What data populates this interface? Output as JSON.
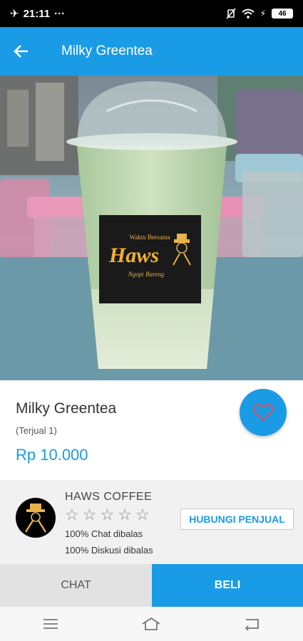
{
  "status_bar": {
    "time": "21:11",
    "dots": "···",
    "battery": "46"
  },
  "app_bar": {
    "title": "Milky Greentea"
  },
  "product": {
    "name": "Milky Greentea",
    "sold": "(Terjual 1)",
    "price": "Rp 10.000",
    "cup_logo": {
      "top_text": "Waktu Bersama",
      "brand": "Haws",
      "bottom_text": "Ngopi Bareng"
    }
  },
  "seller": {
    "name": "HAWS COFFEE",
    "rating_stars": 0,
    "rating_max": 5,
    "chat_stat": "100% Chat dibalas",
    "discussion_stat": "100% Diskusi dibalas",
    "contact_label": "HUBUNGI PENJUAL"
  },
  "actions": {
    "chat_label": "CHAT",
    "buy_label": "BELI"
  },
  "colors": {
    "primary": "#1a9be6",
    "status_bar": "#000000",
    "seller_bg": "#f1f1f1",
    "chat_bg": "#e2e2e2"
  }
}
